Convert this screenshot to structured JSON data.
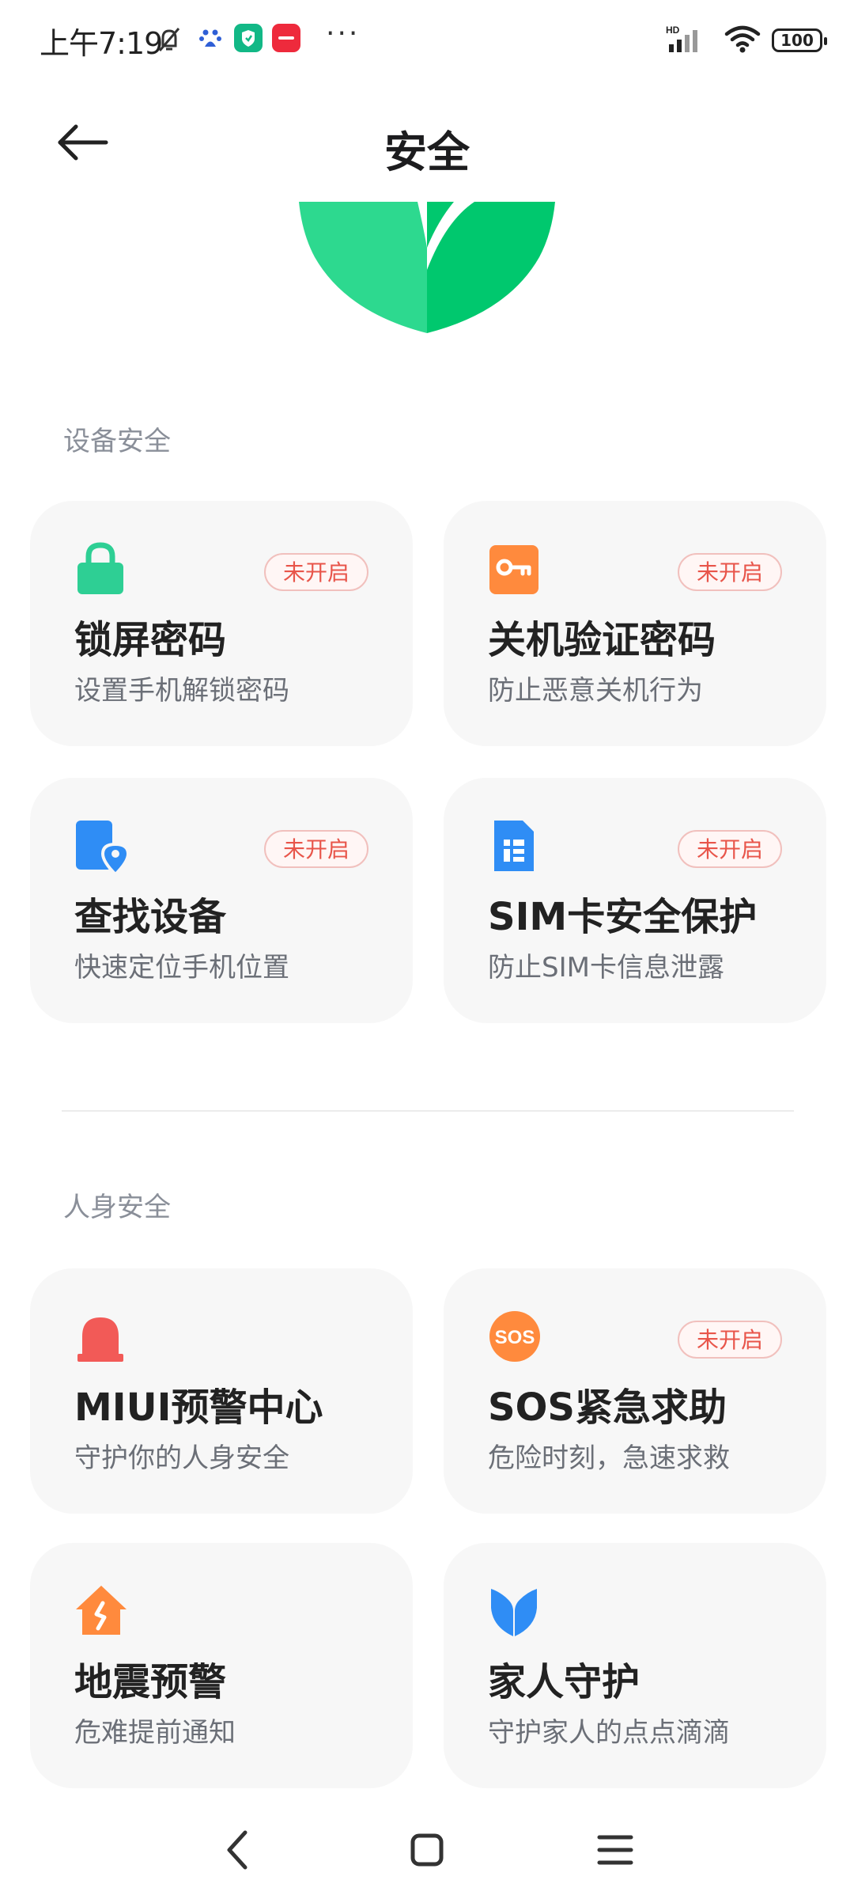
{
  "status_bar": {
    "time": "上午7:19",
    "icons": [
      "bell-off-icon",
      "baidu-paw-icon",
      "green-shield-app-icon",
      "xiaohongshu-app-icon",
      "more-dots-icon",
      "hd-signal-icon",
      "wifi-icon"
    ],
    "more": "···",
    "battery": "100"
  },
  "header": {
    "title": "安全",
    "back_icon": "back-arrow-icon"
  },
  "sections": [
    {
      "title": "设备安全",
      "cards": [
        {
          "title": "锁屏密码",
          "subtitle": "设置手机解锁密码",
          "badge": "未开启",
          "icon": "lock-icon"
        },
        {
          "title": "关机验证密码",
          "subtitle": "防止恶意关机行为",
          "badge": "未开启",
          "icon": "key-icon"
        },
        {
          "title": "查找设备",
          "subtitle": "快速定位手机位置",
          "badge": "未开启",
          "icon": "find-device-icon"
        },
        {
          "title": "SIM卡安全保护",
          "subtitle": "防止SIM卡信息泄露",
          "badge": "未开启",
          "icon": "sim-card-icon"
        }
      ]
    },
    {
      "title": "人身安全",
      "cards": [
        {
          "title": "MIUI预警中心",
          "subtitle": "守护你的人身安全",
          "badge": "",
          "icon": "alarm-light-icon"
        },
        {
          "title": "SOS紧急求助",
          "subtitle": "危险时刻，急速求救",
          "badge": "未开启",
          "icon": "sos-icon"
        },
        {
          "title": "地震预警",
          "subtitle": "危难提前通知",
          "badge": "",
          "icon": "earthquake-house-icon"
        },
        {
          "title": "家人守护",
          "subtitle": "守护家人的点点滴滴",
          "badge": "",
          "icon": "family-guard-icon"
        }
      ]
    }
  ],
  "nav": {
    "icons": [
      "nav-back-icon",
      "nav-home-icon",
      "nav-recents-icon"
    ]
  },
  "colors": {
    "shield_left": "#2dd98f",
    "shield_right": "#00c86e",
    "lock": "#2ecf94",
    "key": "#ff8a3d",
    "find": "#2f8df5",
    "sim": "#2f8df5",
    "alarm": "#f25a57",
    "sos": "#ff8a3d",
    "earthquake": "#ff8a3d",
    "family": "#2f8df5",
    "badge_text": "#e8554a"
  }
}
